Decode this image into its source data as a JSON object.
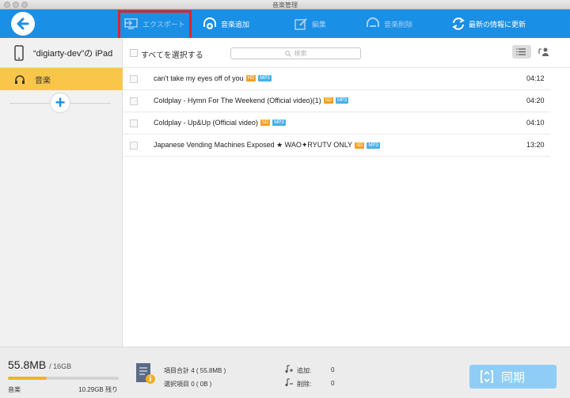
{
  "window": {
    "title": "音楽管理"
  },
  "toolbar": {
    "export_label": "エクスポート",
    "add_label": "音楽追加",
    "edit_label": "編集",
    "delete_label": "音楽削除",
    "refresh_label": "最新の情報に更新"
  },
  "sidebar": {
    "device_name": "“digiarty-dev”の iPad",
    "music_label": "音楽",
    "storage": {
      "used": "55.8MB",
      "total": "/ 16GB",
      "category": "音楽",
      "free": "10.29GB 残り",
      "used_fraction": 0.35
    }
  },
  "list": {
    "select_all_label": "すべてを選択する",
    "search_placeholder": "検索",
    "songs": [
      {
        "title": "can't take my eyes off of you",
        "quality": "HD",
        "format": "MP3",
        "duration": "04:12"
      },
      {
        "title": "Coldplay - Hymn For The Weekend (Official video)(1)",
        "quality": "SD",
        "format": "MP3",
        "duration": "04:20"
      },
      {
        "title": "Coldplay - Up&Up (Official video)",
        "quality": "SD",
        "format": "MP3",
        "duration": "04:10"
      },
      {
        "title": "Japanese Vending Machines Exposed ★ WAO✦RYUTV ONLY",
        "quality": "SD",
        "format": "MP3",
        "duration": "13:20"
      }
    ]
  },
  "footer": {
    "total_items": "項目合計 4 ( 55.8MB )",
    "selected_items": "選択項目 0 ( 0B )",
    "added_label": "追加:",
    "added_value": "0",
    "deleted_label": "削除:",
    "deleted_value": "0",
    "sync_label": "同期"
  },
  "colors": {
    "accent": "#1a8fe6",
    "highlight": "#e0232a",
    "nav_active": "#f9c64a",
    "sync_disabled": "#8fcdf6"
  }
}
